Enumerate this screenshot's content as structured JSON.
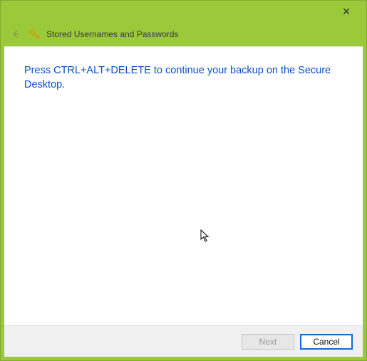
{
  "window": {
    "close_symbol": "✕"
  },
  "header": {
    "title": "Stored Usernames and Passwords"
  },
  "content": {
    "message": "Press CTRL+ALT+DELETE to continue your backup on the Secure Desktop."
  },
  "buttons": {
    "next": "Next",
    "cancel": "Cancel"
  }
}
